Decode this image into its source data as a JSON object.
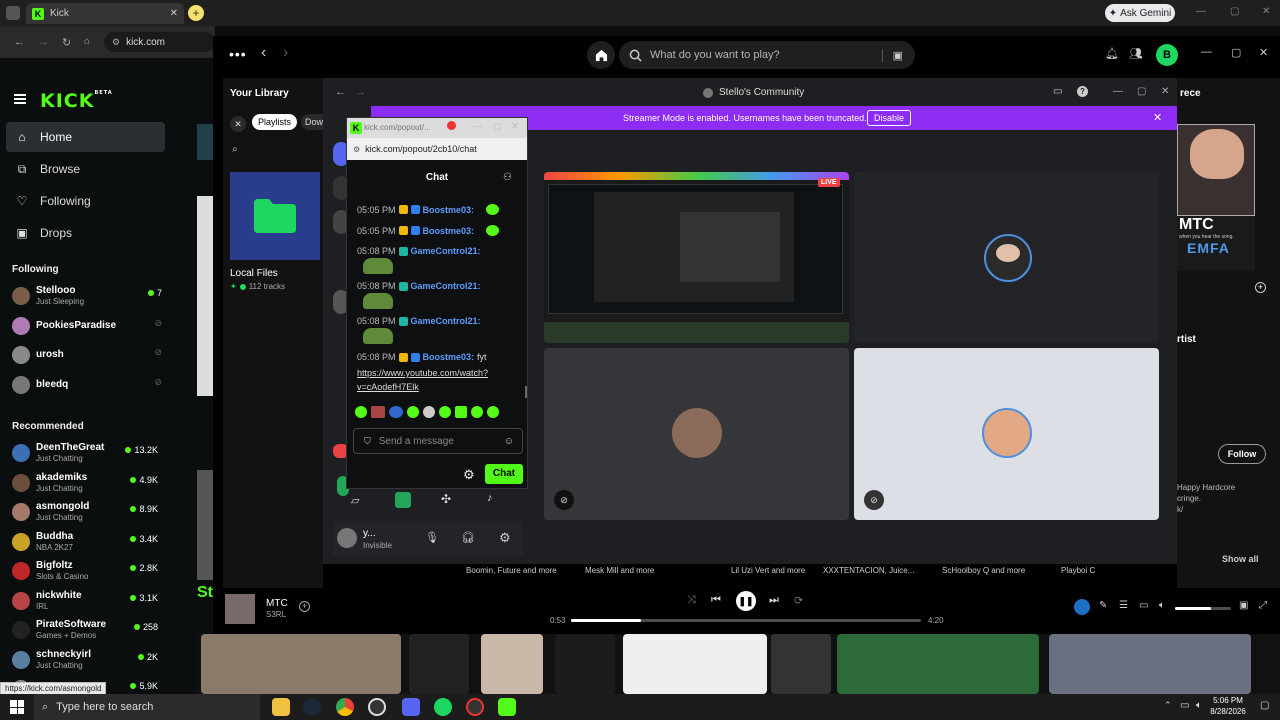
{
  "browser": {
    "tab_title": "Kick",
    "address": "kick.com",
    "ask_gemini": "Ask Gemini",
    "status_url": "https://kick.com/asmongold"
  },
  "kick": {
    "logo": "KICK",
    "logo_tag": "BETA",
    "nav": [
      {
        "label": "Home",
        "icon": "home-icon"
      },
      {
        "label": "Browse",
        "icon": "browse-icon"
      },
      {
        "label": "Following",
        "icon": "heart-icon"
      },
      {
        "label": "Drops",
        "icon": "drops-icon"
      }
    ],
    "following_title": "Following",
    "following": [
      {
        "name": "Stellooo",
        "sub": "Just Sleeping",
        "viewers": "7",
        "live": true,
        "color": "#7a5c4a"
      },
      {
        "name": "PookiesParadise",
        "sub": "",
        "viewers": "",
        "live": false,
        "color": "#b07ab5"
      },
      {
        "name": "urosh",
        "sub": "",
        "viewers": "",
        "live": false,
        "color": "#8a8a8a"
      },
      {
        "name": "bleedq",
        "sub": "",
        "viewers": "",
        "live": false,
        "color": "#777"
      }
    ],
    "recommended_title": "Recommended",
    "recommended": [
      {
        "name": "DeenTheGreat",
        "sub": "Just Chatting",
        "viewers": "13.2K",
        "color": "#3d6fb5"
      },
      {
        "name": "akademiks",
        "sub": "Just Chatting",
        "viewers": "4.9K",
        "color": "#6b4e3d"
      },
      {
        "name": "asmongold",
        "sub": "Just Chatting",
        "viewers": "8.9K",
        "color": "#a5796b"
      },
      {
        "name": "Buddha",
        "sub": "NBA 2K27",
        "viewers": "3.4K",
        "color": "#c9a227"
      },
      {
        "name": "Bigfoltz",
        "sub": "Slots & Casino",
        "viewers": "2.8K",
        "color": "#c02828"
      },
      {
        "name": "nickwhite",
        "sub": "IRL",
        "viewers": "3.1K",
        "color": "#b84545"
      },
      {
        "name": "PirateSoftware",
        "sub": "Games + Demos",
        "viewers": "258",
        "color": "#222"
      },
      {
        "name": "schneckyirl",
        "sub": "Just Chatting",
        "viewers": "2K",
        "color": "#5a7fa0"
      },
      {
        "name": "",
        "sub": "",
        "viewers": "5.9K",
        "color": "#888"
      }
    ],
    "st_text": "St"
  },
  "spotify": {
    "search_placeholder": "What do you want to play?",
    "user_initial": "B",
    "library_title": "Your Library",
    "chip_playlists": "Playlists",
    "chip_dow": "Dow",
    "local_files": "Local Files",
    "tracks": "112 tracks",
    "right_panel": {
      "title_frag": "rece",
      "artist_label": "rtist",
      "follow": "Follow",
      "desc": "Happy Hardcore\ncringe.\nk/",
      "show_all": "Show all",
      "mtc": "MTC",
      "mtc_sub": "when you hear the song."
    },
    "artists_row": [
      "Boomin, Future and more",
      "Mesk Mill and more",
      "Lil Uzi Vert and more",
      "XXXTENTACION, Juice...",
      "ScHoolboy Q and more",
      "Playboi C"
    ],
    "now_playing": {
      "title": "MTC",
      "artist": "S3RL",
      "elapsed": "0:53",
      "total": "4:20",
      "progress": 0.2
    }
  },
  "discord": {
    "title": "Stello's Community",
    "banner": "Streamer Mode is enabled. Usernames have been truncated.",
    "disable": "Disable",
    "live_badge": "LIVE",
    "user_name": "y...",
    "user_status": "Invisible"
  },
  "chat_popup": {
    "url_title": "kick.com/popout/...",
    "url": "kick.com/popout/2cb10/chat",
    "header": "Chat",
    "messages": [
      {
        "time": "05:05 PM",
        "user": "Boostme03:",
        "text": "",
        "emote": true
      },
      {
        "time": "05:05 PM",
        "user": "Boostme03:",
        "text": "",
        "emote": true
      },
      {
        "time": "05:08 PM",
        "user": "GameControl21:",
        "text": "",
        "pepe": true
      },
      {
        "time": "05:08 PM",
        "user": "GameControl21:",
        "text": "",
        "pepe": true
      },
      {
        "time": "05:08 PM",
        "user": "GameControl21:",
        "text": "",
        "pepe": true
      },
      {
        "time": "05:08 PM",
        "user": "Boostme03:",
        "text": "fyt",
        "emote": false
      }
    ],
    "link1": "https://www.youtube.com/watch?",
    "link2": "v=cAodefH7Elk",
    "input_placeholder": "Send a message",
    "send": "Chat"
  },
  "taskbar": {
    "search": "Type here to search",
    "time": "5:06 PM",
    "date": "8/28/2026"
  }
}
